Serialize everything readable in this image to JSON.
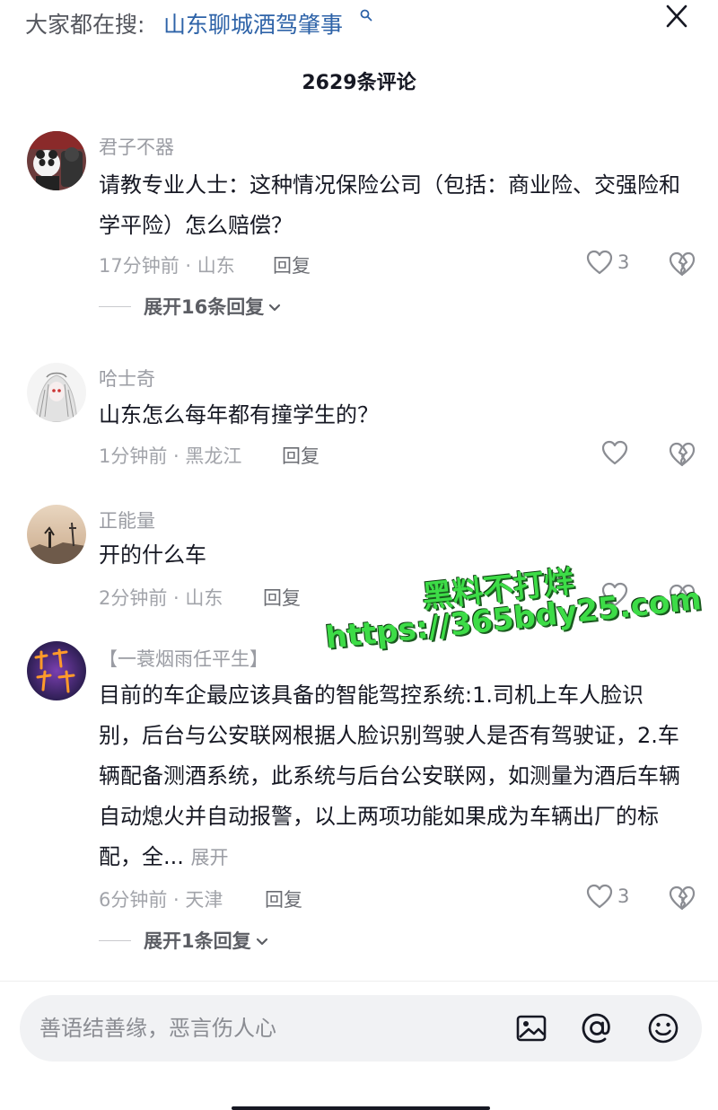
{
  "search": {
    "prefix": "大家都在搜:",
    "term": "山东聊城酒驾肇事"
  },
  "header": {
    "comment_count": "2629条评论"
  },
  "comments": [
    {
      "username": "君子不器",
      "text": "请教专业人士：这种情况保险公司（包括：商业险、交强险和学平险）怎么赔偿？",
      "time": "17分钟前",
      "location": "山东",
      "reply_label": "回复",
      "likes": "3",
      "expand_label": "展开16条回复"
    },
    {
      "username": "哈士奇",
      "text": "山东怎么每年都有撞学生的？",
      "time": "1分钟前",
      "location": "黑龙江",
      "reply_label": "回复",
      "likes": ""
    },
    {
      "username": "正能量",
      "text": "开的什么车",
      "time": "2分钟前",
      "location": "山东",
      "reply_label": "回复",
      "likes": ""
    },
    {
      "username": "【一蓑烟雨任平生】",
      "text": "目前的车企最应该具备的智能驾控系统:1.司机上车人脸识别，后台与公安联网根据人脸识别驾驶人是否有驾驶证，2.车辆配备测酒系统，此系统与后台公安联网，如测量为酒后车辆自动熄火并自动报警，以上两项功能如果成为车辆出厂的标配，全...",
      "more_label": "展开",
      "time": "6分钟前",
      "location": "天津",
      "reply_label": "回复",
      "likes": "3",
      "expand_label": "展开1条回复"
    }
  ],
  "watermark": {
    "line1": "黑料不打烊",
    "line2": "https://365bdy25.com"
  },
  "input": {
    "placeholder": "善语结善缘，恶言伤人心"
  },
  "icons": {
    "search": "search-icon",
    "close": "close-icon",
    "like": "heart-outline-icon",
    "dislike": "broken-heart-icon",
    "chevron": "chevron-down-icon",
    "image": "image-icon",
    "mention": "at-icon",
    "emoji": "emoji-icon"
  },
  "colors": {
    "link_blue": "#2e63a8",
    "text_primary": "#161823",
    "text_secondary": "#9a9ca3",
    "watermark_green": "#3ddc47"
  }
}
